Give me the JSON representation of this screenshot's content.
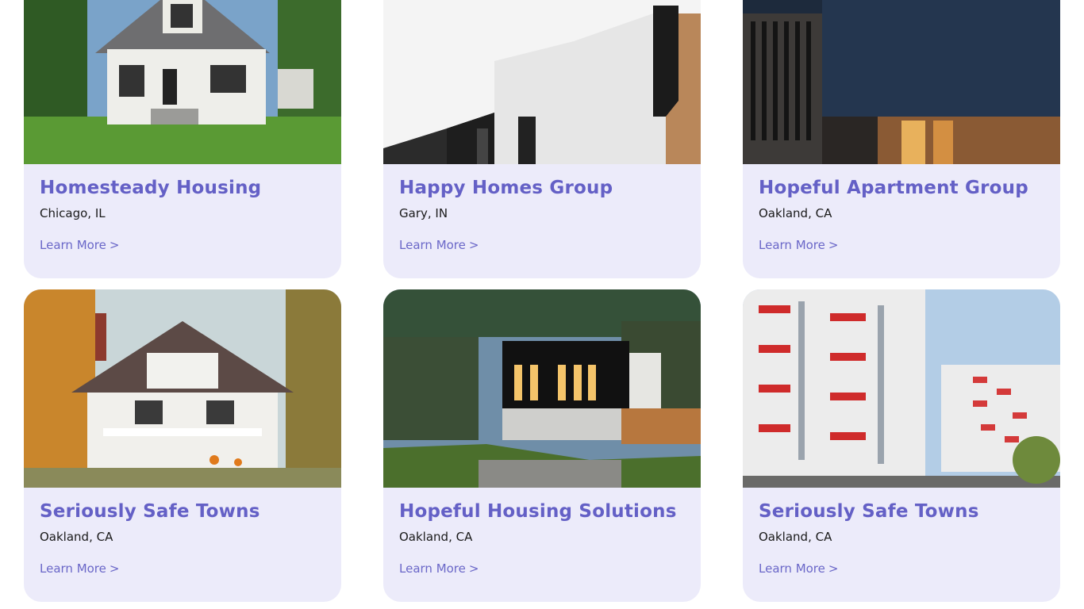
{
  "cards": [
    {
      "name": "Homesteady Housing",
      "location": "Chicago, IL",
      "link": "Learn More",
      "chevron": ">"
    },
    {
      "name": "Happy Homes Group",
      "location": "Gary, IN",
      "link": "Learn More",
      "chevron": ">"
    },
    {
      "name": "Hopeful Apartment Group",
      "location": "Oakland, CA",
      "link": "Learn More",
      "chevron": ">"
    },
    {
      "name": "Seriously Safe Towns",
      "location": "Oakland, CA",
      "link": "Learn More",
      "chevron": ">"
    },
    {
      "name": "Hopeful Housing Solutions",
      "location": "Oakland, CA",
      "link": "Learn More",
      "chevron": ">"
    },
    {
      "name": "Seriously Safe Towns",
      "location": "Oakland, CA",
      "link": "Learn More",
      "chevron": ">"
    }
  ],
  "colors": {
    "title": "#6460c6",
    "link": "#6a67c8",
    "card_bg": "#ecebfa"
  }
}
